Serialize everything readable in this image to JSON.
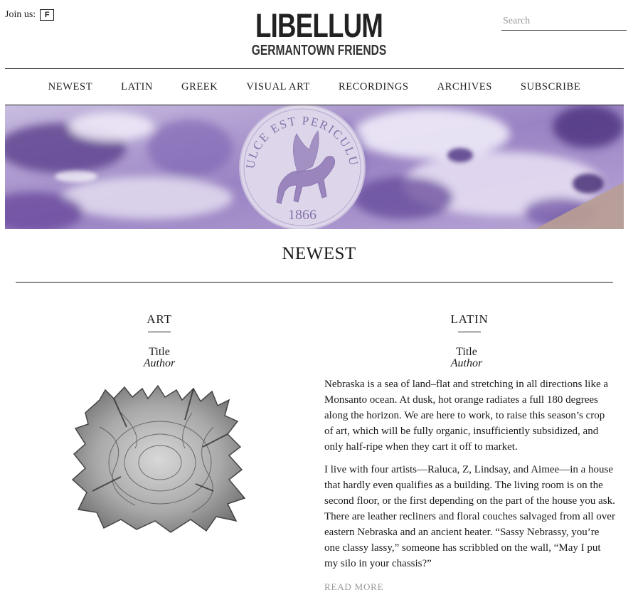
{
  "header": {
    "join_label": "Join us:",
    "social_icon": "facebook-icon",
    "social_glyph": "F",
    "logo_title": "LIBELLUM",
    "logo_subtitle": "GERMANTOWN FRIENDS",
    "search_placeholder": "Search"
  },
  "nav": {
    "items": [
      "NEWEST",
      "LATIN",
      "GREEK",
      "VISUAL ART",
      "RECORDINGS",
      "ARCHIVES",
      "SUBSCRIBE"
    ]
  },
  "banner": {
    "seal_text_top": "DULCE EST PERICULUM",
    "seal_year": "1866",
    "accent_color": "#7a5ca8",
    "image_description": "purple marbled background with pegasus seal"
  },
  "section": {
    "title": "NEWEST"
  },
  "columns": [
    {
      "heading": "ART",
      "title": "Title",
      "author": "Author",
      "image": "artwork-image"
    },
    {
      "heading": "LATIN",
      "title": "Title",
      "author": "Author",
      "paragraphs": [
        "Nebraska is a sea of land–flat and stretching in all directions like a Monsanto ocean. At dusk, hot orange radiates a full 180 degrees along the horizon. We are here to work, to raise this season’s crop of art, which will be fully organic, insufficiently subsidized, and only half-ripe when they cart it off to market.",
        "I live with four artists—Raluca, Z, Lindsay, and Aimee—in a house that hardly even qualifies as a building. The living room is on the second floor, or the first depending on the part of the house you ask. There are leather recliners and floral couches salvaged from all over eastern Nebraska and an ancient heater. “Sassy Nebrassy, you’re one classy lassy,” someone has scribbled on the wall, “May I put my silo in your chassis?”"
      ],
      "read_more": "READ MORE"
    }
  ]
}
